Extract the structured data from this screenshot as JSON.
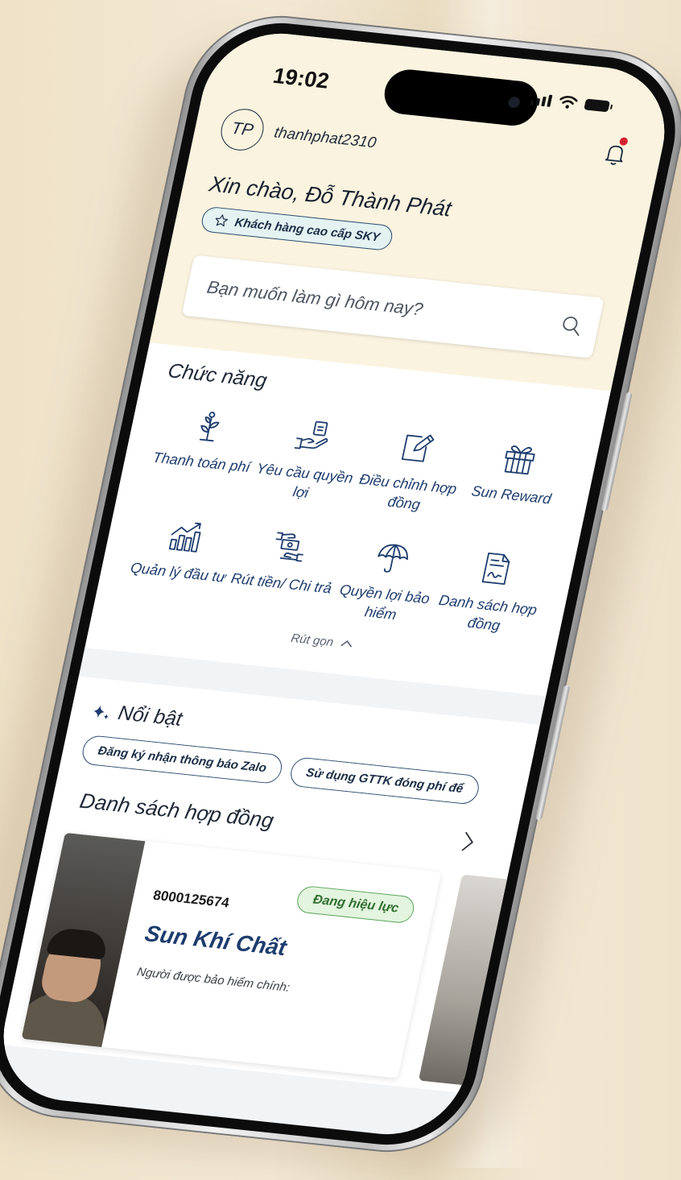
{
  "status_bar": {
    "time": "19:02"
  },
  "user": {
    "initials": "TP",
    "username": "thanhphat2310"
  },
  "greeting": "Xin chào, Đỗ Thành Phát",
  "tier_badge": "Khách hàng cao cấp SKY",
  "search": {
    "placeholder": "Bạn muốn làm gì hôm nay?"
  },
  "features": {
    "title": "Chức năng",
    "items": [
      {
        "label": "Thanh toán phí",
        "icon": "sprout-icon"
      },
      {
        "label": "Yêu cầu quyền lợi",
        "icon": "hand-document-icon"
      },
      {
        "label": "Điều chỉnh hợp đồng",
        "icon": "edit-document-icon"
      },
      {
        "label": "Sun Reward",
        "icon": "gift-icon"
      },
      {
        "label": "Quản lý đầu tư",
        "icon": "growth-chart-icon"
      },
      {
        "label": "Rút tiền/ Chi trả",
        "icon": "cash-hands-icon"
      },
      {
        "label": "Quyền lợi bảo hiểm",
        "icon": "umbrella-icon"
      },
      {
        "label": "Danh sách hợp đồng",
        "icon": "contract-list-icon"
      }
    ],
    "collapse_label": "Rút gọn"
  },
  "highlights": {
    "title": "Nổi bật",
    "chips": [
      "Đăng ký nhận thông báo Zalo",
      "Sử dụng GTTK đóng phí để"
    ]
  },
  "contracts": {
    "title": "Danh sách hợp đồng",
    "items": [
      {
        "number": "8000125674",
        "status": "Đang hiệu lực",
        "product": "Sun Khí Chất",
        "insured_label": "Người được bảo hiểm chính:"
      }
    ]
  },
  "colors": {
    "header_bg": "#faf3df",
    "primary_text": "#1d3c6e",
    "badge_bg": "#e4f3f2",
    "status_active_bg": "#e3f4df",
    "status_active_border": "#5aa55a",
    "notification_dot": "#d3232f"
  }
}
